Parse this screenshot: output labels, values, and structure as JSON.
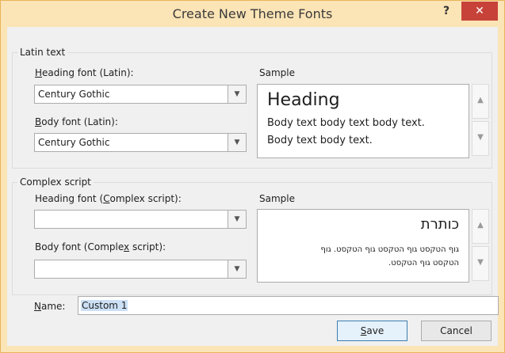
{
  "window": {
    "title": "Create New Theme Fonts",
    "help_label": "?",
    "close_label": "✕"
  },
  "latin": {
    "group_label": "Latin text",
    "heading_label": {
      "pre": "",
      "key": "H",
      "post": "eading font (Latin):"
    },
    "heading_value": "Century Gothic",
    "body_label": {
      "pre": "",
      "key": "B",
      "post": "ody font (Latin):"
    },
    "body_value": "Century Gothic",
    "sample_label": "Sample",
    "sample_heading": "Heading",
    "sample_body_line1": "Body text body text body text.",
    "sample_body_line2": "Body text body text."
  },
  "complex": {
    "group_label": "Complex script",
    "heading_label": {
      "pre": "Heading font (",
      "key": "C",
      "post": "omplex script):"
    },
    "heading_value": "",
    "body_label": {
      "pre": "Body font (Comple",
      "key": "x",
      "post": " script):"
    },
    "body_value": "",
    "sample_label": "Sample",
    "sample_heading": "כותרת",
    "sample_body_line1": "גוף הטקסט גוף הטקסט גוף הטקסט. גוף",
    "sample_body_line2": "הטקסט גוף הטקסט."
  },
  "name": {
    "label_key": "N",
    "label_post": "ame:",
    "value": "Custom 1"
  },
  "buttons": {
    "save": {
      "key": "S",
      "post": "ave"
    },
    "cancel": "Cancel"
  },
  "icons": {
    "combo_arrow": "chevron-down-icon",
    "scroll_up": "chevron-up-icon",
    "scroll_down": "chevron-down-icon"
  }
}
